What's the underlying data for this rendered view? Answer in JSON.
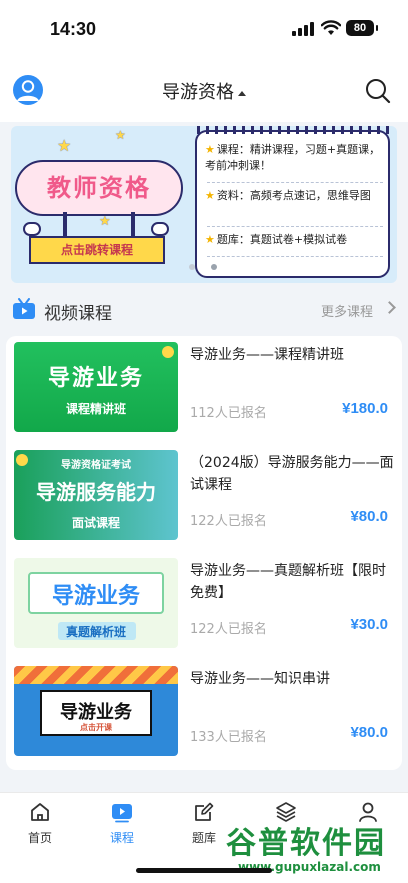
{
  "status_bar": {
    "time": "14:30",
    "battery": "80"
  },
  "header": {
    "title": "导游资格"
  },
  "banner": {
    "headline": "教师资格",
    "cta": "点击跳转课程",
    "items": [
      "课程：精讲课程，习题+真题课，考前冲刺课！",
      "资料：高频考点速记，思维导图",
      "题库：真题试卷+模拟试卷"
    ]
  },
  "section": {
    "title": "视频课程",
    "more": "更多课程"
  },
  "courses": [
    {
      "title": "导游业务——课程精讲班",
      "enrolled": "112人已报名",
      "price": "¥180.0",
      "thumb_main": "导游业务",
      "thumb_sub": "课程精讲班",
      "thumb_top": ""
    },
    {
      "title": "（2024版）导游服务能力——面试课程",
      "enrolled": "122人已报名",
      "price": "¥80.0",
      "thumb_main": "导游服务能力",
      "thumb_sub": "面试课程",
      "thumb_top": "导游资格证考试"
    },
    {
      "title": "导游业务——真题解析班【限时免费】",
      "enrolled": "122人已报名",
      "price": "¥30.0",
      "thumb_main": "导游业务",
      "thumb_sub": "真题解析班",
      "thumb_top": ""
    },
    {
      "title": "导游业务——知识串讲",
      "enrolled": "133人已报名",
      "price": "¥80.0",
      "thumb_main": "导游业务",
      "thumb_sub": "点击开课",
      "thumb_top": ""
    }
  ],
  "tabbar": [
    {
      "label": "首页",
      "icon": "home-icon"
    },
    {
      "label": "课程",
      "icon": "play-icon"
    },
    {
      "label": "题库",
      "icon": "edit-icon"
    },
    {
      "label": "",
      "icon": "layers-icon"
    },
    {
      "label": "",
      "icon": "user-icon"
    }
  ],
  "watermark": {
    "title": "谷普软件园",
    "url": "www.gupuxlazal.com"
  },
  "colors": {
    "accent": "#2f8df5",
    "price": "#2f8df5",
    "banner_bg": "#d7ecfa"
  }
}
